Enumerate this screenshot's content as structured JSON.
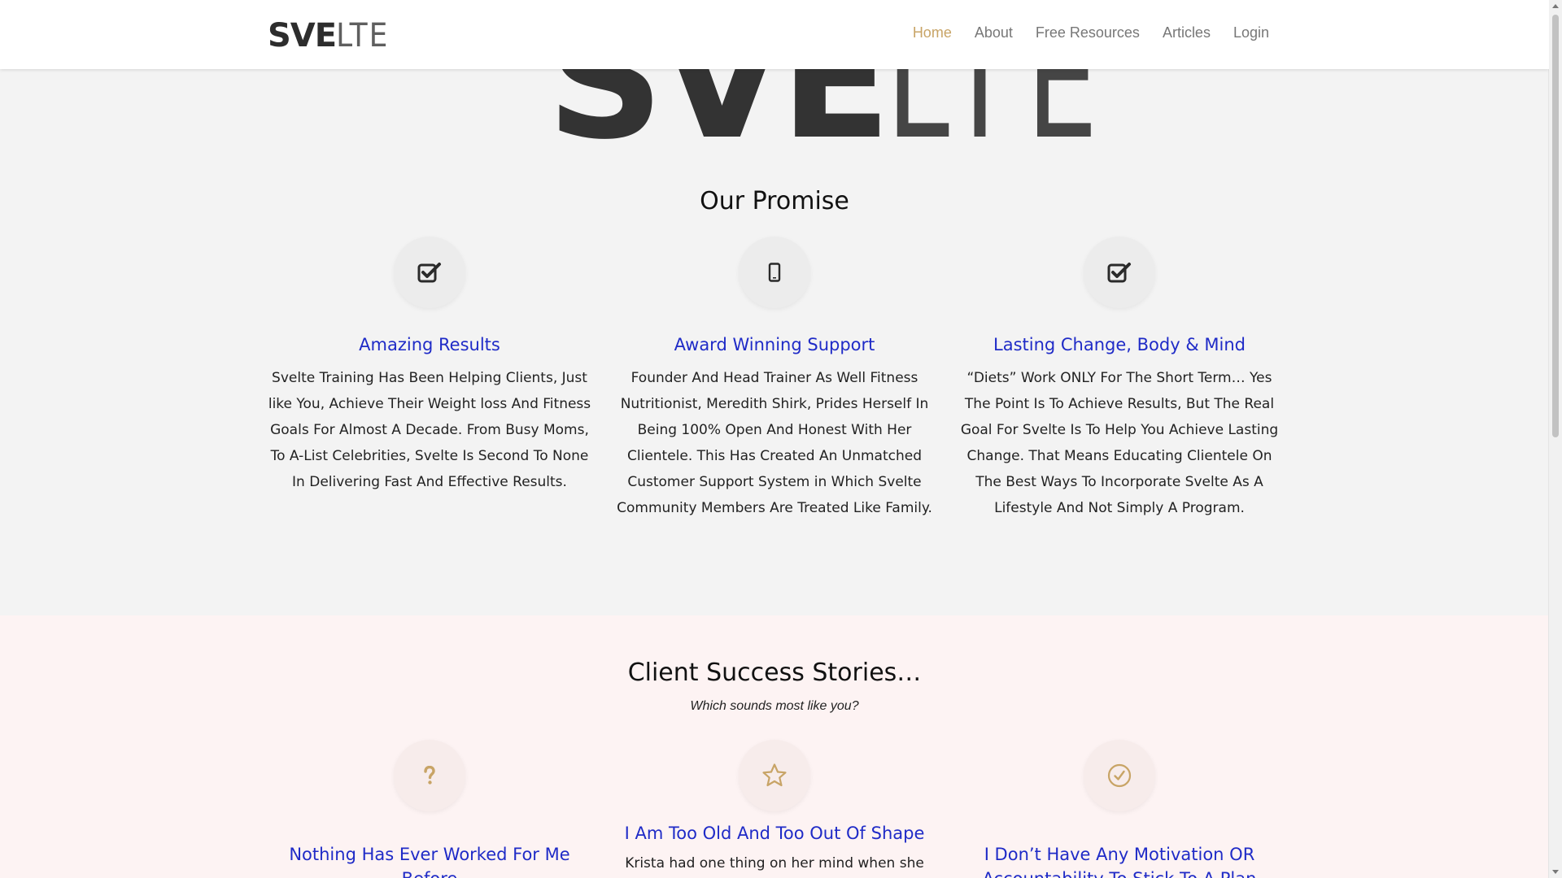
{
  "header": {
    "logo_bold": "SVE",
    "logo_thin": "LTE",
    "nav": [
      {
        "label": "Home",
        "active": true
      },
      {
        "label": "About"
      },
      {
        "label": "Free Resources"
      },
      {
        "label": "Articles"
      },
      {
        "label": "Login"
      }
    ]
  },
  "hero": {
    "logo_bold": "SVE",
    "logo_thin": "LTE"
  },
  "promise": {
    "title": "Our Promise",
    "items": [
      {
        "icon": "check-square-icon",
        "title": "Amazing Results",
        "text": "Svelte Training Has Been Helping Clients, Just like You, Achieve Their Weight loss And Fitness Goals For Almost A Decade.  From Busy Moms, To A-List Celebrities, Svelte Is Second To None In Delivering Fast And Effective Results."
      },
      {
        "icon": "mobile-phone-icon",
        "title": "Award Winning Support",
        "text": "Founder And Head Trainer As Well Fitness Nutritionist, Meredith Shirk, Prides Herself In Being 100% Open And Honest With Her Clientele.  This Has Created An Unmatched Customer Support  System in Which Svelte Community Members Are Treated Like Family."
      },
      {
        "icon": "check-square-icon",
        "title": "Lasting Change, Body & Mind",
        "text": "“Diets” Work ONLY For The Short Term… Yes The Point Is To Achieve Results, But The Real Goal For Svelte Is To Help You Achieve Lasting Change.  That Means Educating Clientele On The Best Ways To Incorporate Svelte As A Lifestyle And Not Simply A Program."
      }
    ]
  },
  "stories": {
    "title": "Client Success Stories…",
    "subtitle": "Which sounds most like you?",
    "items": [
      {
        "icon": "question-mark-icon",
        "title": "Nothing Has Ever Worked For Me Before",
        "text": ""
      },
      {
        "icon": "star-icon",
        "title": "I Am Too Old And Too Out Of Shape",
        "text": "Krista had one thing on her mind when she"
      },
      {
        "icon": "clock-check-icon",
        "title": "I Don’t Have Any Motivation OR Accountability To Stick To A Plan",
        "text": ""
      }
    ]
  },
  "colors": {
    "accent_gold": "#c8a466",
    "link_blue": "#1f2bc7",
    "pink_band": "#fdf3f3"
  }
}
